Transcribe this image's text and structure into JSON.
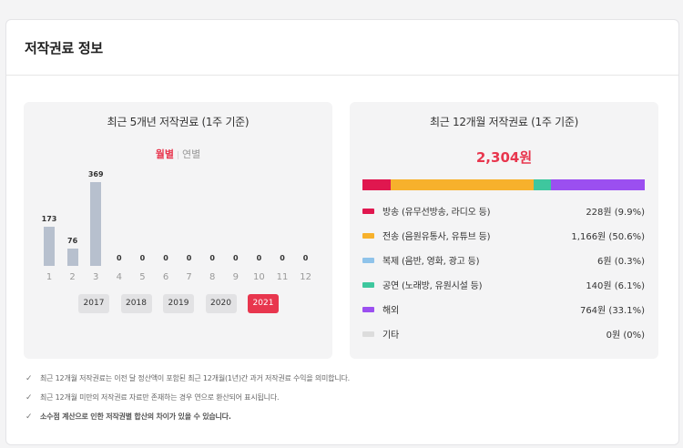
{
  "header": {
    "title": "저작권료 정보"
  },
  "left_panel": {
    "title": "최근 5개년 저작권료 (1주 기준)",
    "toggle": {
      "monthly": "월별",
      "separator": "|",
      "yearly": "연별"
    },
    "years": [
      "2017",
      "2018",
      "2019",
      "2020",
      "2021"
    ],
    "selected_year": "2021"
  },
  "right_panel": {
    "title": "최근 12개월 저작권료 (1주 기준)",
    "total": "2,304원",
    "categories": [
      {
        "label": "방송 (유무선방송, 라디오 등)",
        "value": "228원 (9.9%)",
        "share": 9.9,
        "color": "#e0174f"
      },
      {
        "label": "전송 (음원유통사, 유튜브 등)",
        "value": "1,166원 (50.6%)",
        "share": 50.6,
        "color": "#f7b12c"
      },
      {
        "label": "복제 (음반, 영화, 광고 등)",
        "value": "6원 (0.3%)",
        "share": 0.3,
        "color": "#8fc3ea"
      },
      {
        "label": "공연 (노래방, 유원시설 등)",
        "value": "140원 (6.1%)",
        "share": 6.1,
        "color": "#3ec79e"
      },
      {
        "label": "해외",
        "value": "764원 (33.1%)",
        "share": 33.1,
        "color": "#9b4ff0"
      },
      {
        "label": "기타",
        "value": "0원 (0%)",
        "share": 0,
        "color": "#dcdcdc"
      }
    ]
  },
  "chart_data": {
    "type": "bar",
    "categories": [
      "1",
      "2",
      "3",
      "4",
      "5",
      "6",
      "7",
      "8",
      "9",
      "10",
      "11",
      "12"
    ],
    "values": [
      173,
      76,
      369,
      0,
      0,
      0,
      0,
      0,
      0,
      0,
      0,
      0
    ],
    "ylim": [
      0,
      369
    ],
    "title": "최근 5개년 저작권료 (1주 기준)",
    "xlabel": "",
    "ylabel": ""
  },
  "notes": [
    {
      "text": "최근 12개월 저작권료는 이전 달 정산액이 포함된 최근 12개월(1년)간 과거 저작권료 수익을 의미합니다.",
      "bold": false
    },
    {
      "text": "최근 12개월 미만의 저작권료 자료만 존재하는 경우 연으로 환산되어 표시됩니다.",
      "bold": false
    },
    {
      "text": "소수점 계산으로 인한 저작권별 합산의 차이가 있을 수 있습니다.",
      "bold": true
    }
  ]
}
